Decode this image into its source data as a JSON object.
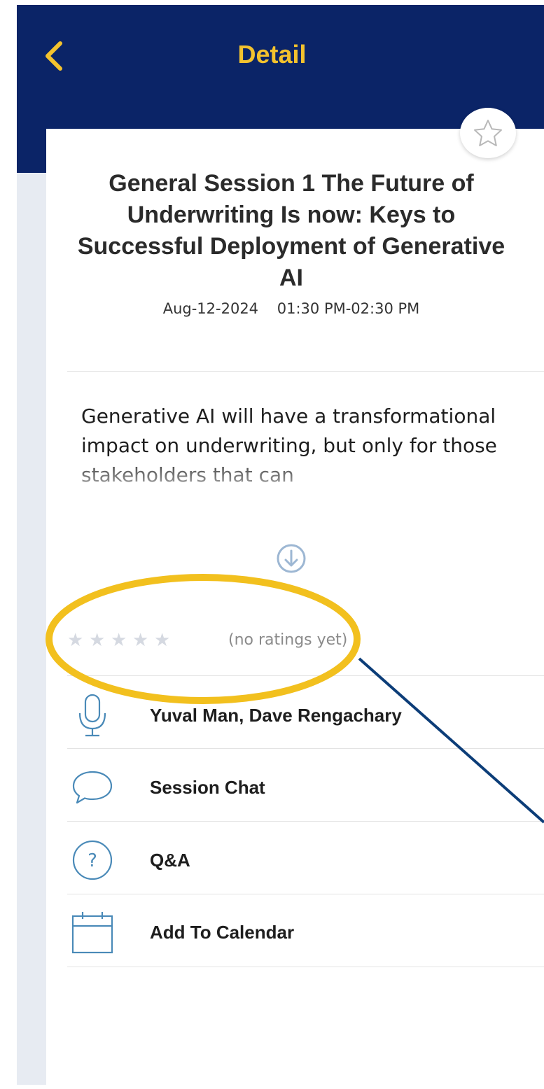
{
  "nav": {
    "title": "Detail"
  },
  "session": {
    "title": "General Session 1 The Future of Underwriting Is now: Keys to Successful Deployment of Generative AI",
    "date": "Aug-12-2024",
    "time": "01:30 PM-02:30 PM",
    "datetime": "Aug-12-2024    01:30 PM-02:30 PM",
    "description": "Generative AI will have a transformational impact on underwriting, but only for those stakeholders that can",
    "rating_text": "(no ratings yet)",
    "rating_value": 0,
    "rating_max": 5
  },
  "rows": [
    {
      "icon": "microphone-icon",
      "label": "Yuval Man, Dave Rengachary"
    },
    {
      "icon": "chat-bubble-icon",
      "label": "Session Chat"
    },
    {
      "icon": "question-circle-icon",
      "label": "Q&A"
    },
    {
      "icon": "calendar-icon",
      "label": "Add To Calendar"
    }
  ],
  "colors": {
    "nav_background": "#0b2467",
    "accent_yellow": "#f3c22e",
    "icon_blue": "#4a8ab8",
    "content_background": "#e7ebf2",
    "annotation_line": "#0c3d78"
  }
}
